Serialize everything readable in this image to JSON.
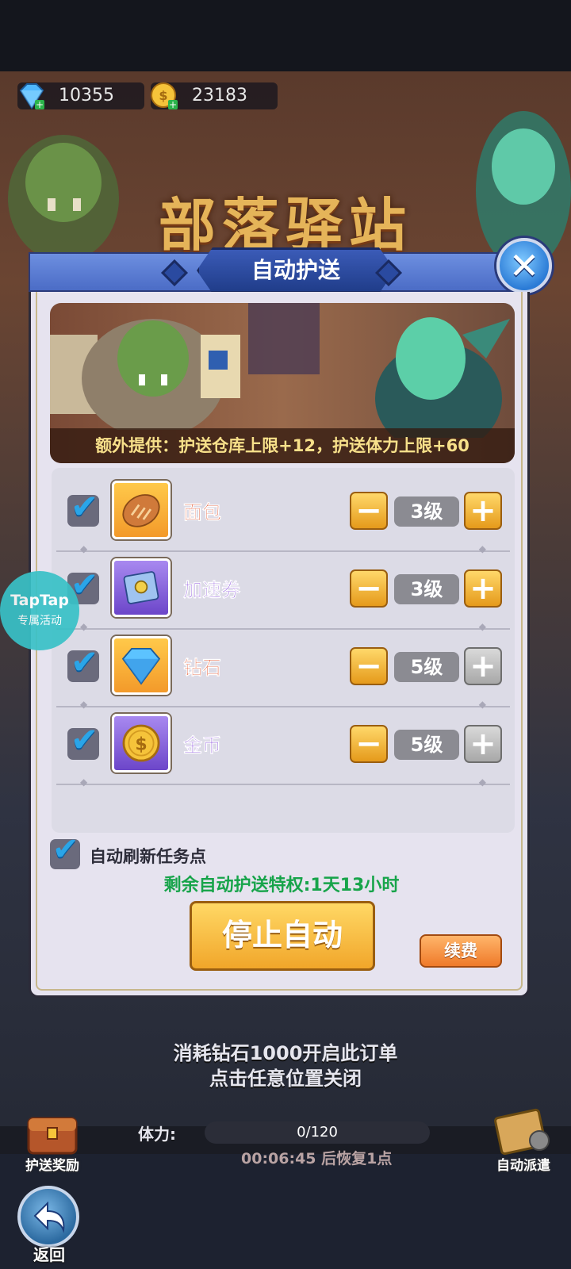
{
  "currency": {
    "gems": "10355",
    "gold": "23183"
  },
  "background_title": "部落驿站",
  "dialog": {
    "title": "自动护送",
    "close_label": "✕",
    "banner_note": "额外提供：护送仓库上限+12，护送体力上限+60",
    "items": [
      {
        "name": "面包",
        "level": "3级",
        "checked": true,
        "plus_enabled": true,
        "icon": "bread-icon"
      },
      {
        "name": "加速券",
        "level": "3级",
        "checked": true,
        "plus_enabled": true,
        "icon": "scroll-icon"
      },
      {
        "name": "钻石",
        "level": "5级",
        "checked": true,
        "plus_enabled": false,
        "icon": "diamond-icon"
      },
      {
        "name": "金币",
        "level": "5级",
        "checked": true,
        "plus_enabled": false,
        "icon": "gold-coin-icon"
      }
    ],
    "minus_label": "−",
    "plus_label": "+",
    "auto_refresh_label": "自动刷新任务点",
    "privilege_text": "剩余自动护送特权:1天13小时",
    "stop_button": "停止自动",
    "renew_button": "续费"
  },
  "taptap": {
    "brand": "TapTap",
    "subtitle": "专属活动"
  },
  "hints": {
    "line1": "消耗钻石1000开启此订单",
    "line2": "点击任意位置关闭"
  },
  "stamina": {
    "label": "体力:",
    "value": "0/120",
    "fill_fraction": 0,
    "recover_text": "00:06:45 后恢复1点"
  },
  "bottom": {
    "reward_label": "护送奖励",
    "dispatch_label": "自动派遣",
    "back_label": "返回"
  }
}
